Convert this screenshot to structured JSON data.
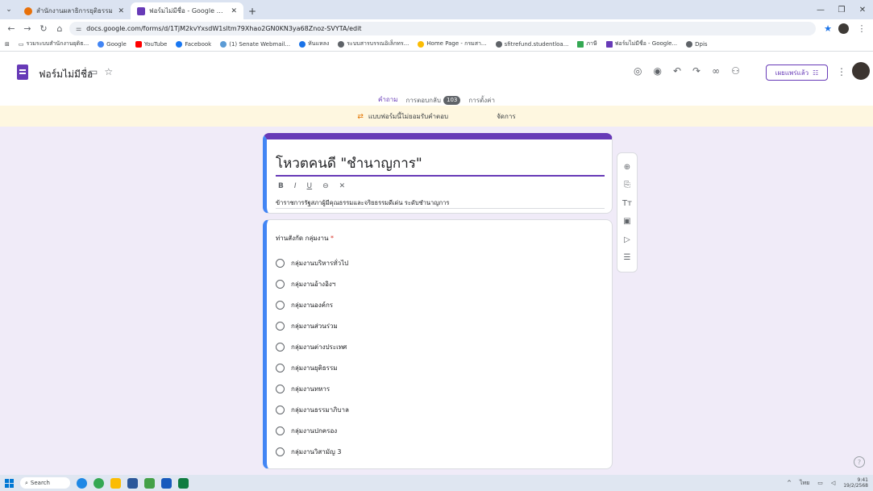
{
  "browser": {
    "tabs": [
      {
        "title": "สำนักงานผลาธิการยุติธรรม",
        "active": false,
        "color": "#e8710a"
      },
      {
        "title": "ฟอร์มไม่มีชื่อ - Google ฟอร์ม",
        "active": true,
        "color": "#673ab7"
      }
    ],
    "new_tab": "+",
    "url": "docs.google.com/forms/d/1TjM2kvYxsdW1sltm79Xhao2GN0KN3ya68Znoz-SVYTA/edit",
    "bookmarks": [
      "รวมระบบสำนักงานยุติธ...",
      "Google",
      "YouTube",
      "Facebook",
      "(1) Senate Webmail...",
      "หันแหลง",
      "ระบบสารบรรณอิเล็กทร...",
      "Home Page - กรมสา...",
      "sfitrefund.studentloa...",
      "ภาษี",
      "ฟอร์มไม่มีชื่อ - Google...",
      "Dpis"
    ]
  },
  "forms_header": {
    "title": "ฟอร์มไม่มีชื่อ",
    "publish_label": "เผยแพร่แล้ว",
    "tabs": [
      {
        "label": "คำถาม",
        "active": true
      },
      {
        "label": "การตอบกลับ",
        "badge": "103",
        "active": false
      },
      {
        "label": "การตั้งค่า",
        "active": false
      }
    ]
  },
  "banner": {
    "message": "แบบฟอร์มนี้ไม่ยอมรับคำตอบ",
    "action": "จัดการ"
  },
  "form": {
    "title": "โหวตคนดี \"ชำนาญการ\"",
    "description": "ข้าราชการรัฐสภาผู้มีคุณธรรมและจริยธรรมดีเด่น ระดับชำนาญการ",
    "format_buttons": [
      "B",
      "I",
      "U",
      "⊖",
      "✕"
    ]
  },
  "question": {
    "title": "ท่านสังกัด กลุ่มงาน",
    "required_mark": "*",
    "options": [
      "กลุ่มงานบริหารทั่วไป",
      "กลุ่มงานอ้างอิงฯ",
      "กลุ่มงานองค์กร",
      "กลุ่มงานส่วนร่วม",
      "กลุ่มงานต่างประเทศ",
      "กลุ่มงานยุติธรรม",
      "กลุ่มงานทหาร",
      "กลุ่มงานธรรมาภิบาล",
      "กลุ่มงานปกครอง",
      "กลุ่มงานวิสามัญ 3"
    ]
  },
  "taskbar": {
    "search": "Search",
    "lang": "ไทย",
    "time": "9:41",
    "date": "19/2/2568"
  },
  "colors": {
    "accent": "#673ab7",
    "background": "#f0ebf8",
    "banner": "#fef7e0",
    "question_bar": "#4285f4"
  }
}
